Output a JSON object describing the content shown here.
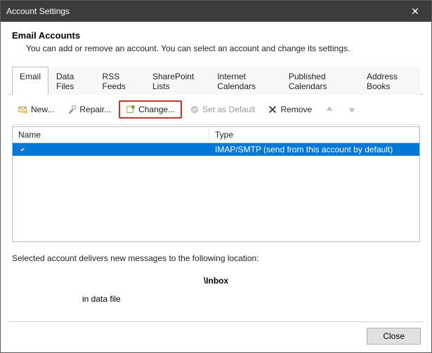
{
  "window": {
    "title": "Account Settings"
  },
  "header": {
    "heading": "Email Accounts",
    "subheading": "You can add or remove an account. You can select an account and change its settings."
  },
  "tabs": [
    {
      "label": "Email",
      "active": true
    },
    {
      "label": "Data Files"
    },
    {
      "label": "RSS Feeds"
    },
    {
      "label": "SharePoint Lists"
    },
    {
      "label": "Internet Calendars"
    },
    {
      "label": "Published Calendars"
    },
    {
      "label": "Address Books"
    }
  ],
  "toolbar": {
    "new_label": "New...",
    "repair_label": "Repair...",
    "change_label": "Change...",
    "set_default_label": "Set as Default",
    "remove_label": "Remove"
  },
  "table": {
    "col_name": "Name",
    "col_type": "Type",
    "rows": [
      {
        "name": "",
        "type": "IMAP/SMTP (send from this account by default)"
      }
    ]
  },
  "footer": {
    "line1": "Selected account delivers new messages to the following location:",
    "path": "\\Inbox",
    "file": "in data file"
  },
  "buttons": {
    "close": "Close"
  }
}
